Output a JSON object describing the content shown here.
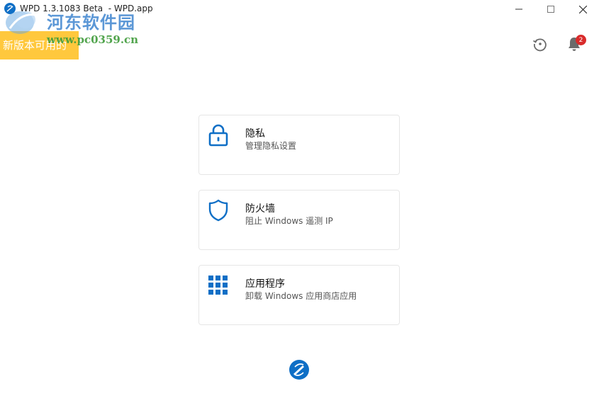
{
  "window": {
    "title": "WPD 1.3.1083 Beta  - WPD.app",
    "controls": {
      "minimize": "minimize-icon",
      "maximize": "maximize-icon",
      "close": "close-icon"
    }
  },
  "banner": {
    "text": "新版本可用的"
  },
  "watermark": {
    "site_name": "河东软件园",
    "url": "www.pc0359.cn"
  },
  "header": {
    "history_icon": "history-icon",
    "bell_icon": "bell-icon",
    "notification_count": "2"
  },
  "cards": [
    {
      "icon": "lock-icon",
      "title": "隐私",
      "subtitle": "管理隐私设置"
    },
    {
      "icon": "shield-icon",
      "title": "防火墙",
      "subtitle": "阻止 Windows 遥测 IP"
    },
    {
      "icon": "grid-icon",
      "title": "应用程序",
      "subtitle": "卸载 Windows 应用商店应用"
    }
  ],
  "colors": {
    "accent": "#0f6fc6",
    "banner": "#ffc83d",
    "badge": "#d92b2b"
  }
}
